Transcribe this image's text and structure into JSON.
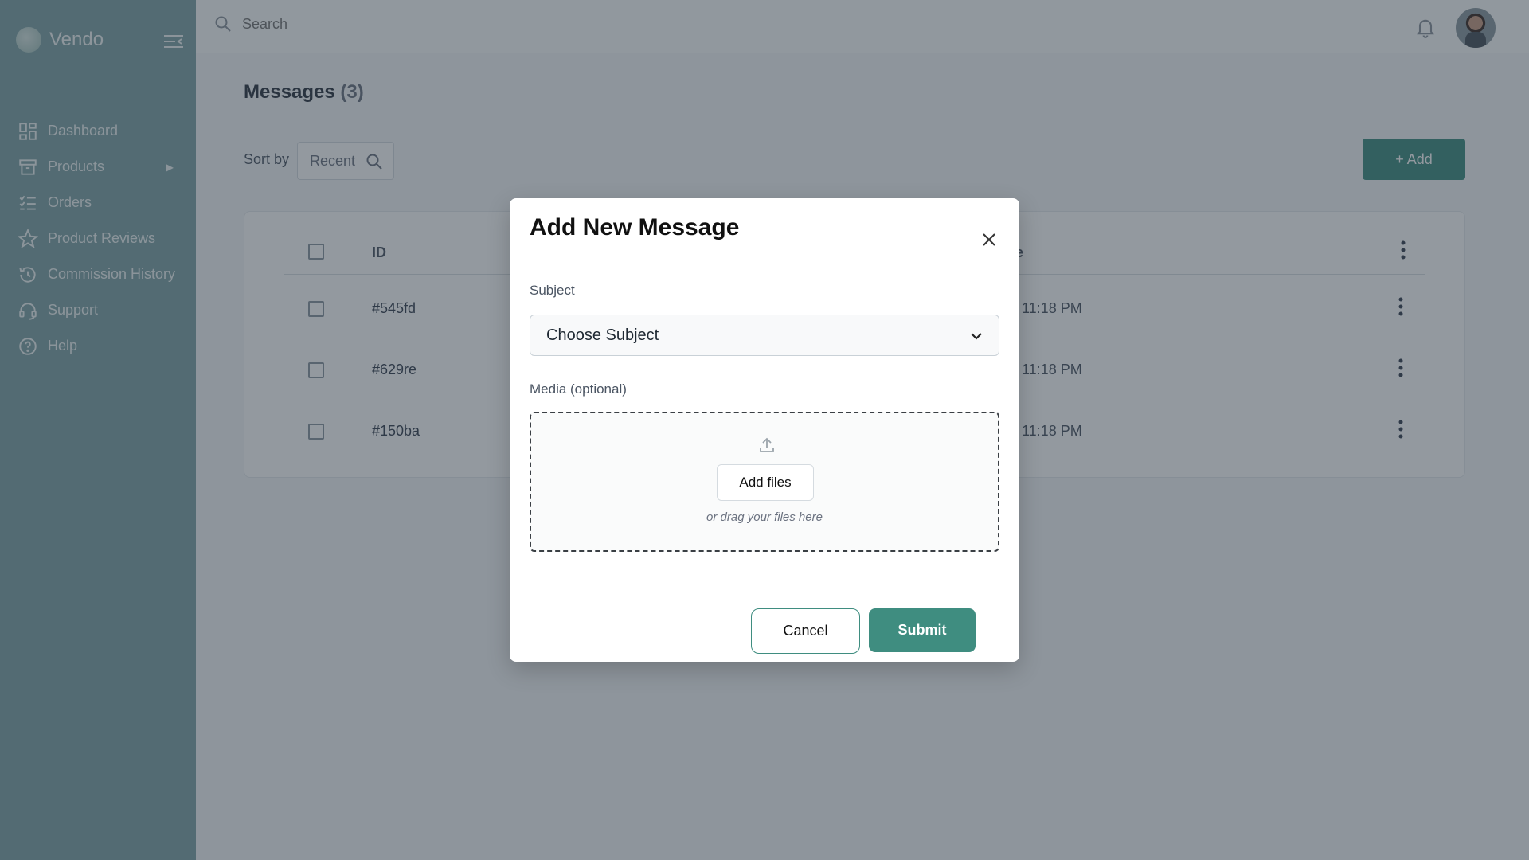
{
  "app": {
    "brand": "Vendo"
  },
  "sidebar": {
    "items": [
      {
        "label": "Dashboard",
        "icon": "dashboard-icon"
      },
      {
        "label": "Products",
        "icon": "box-icon",
        "expand": "▶"
      },
      {
        "label": "Orders",
        "icon": "checklist-icon"
      },
      {
        "label": "Product Reviews",
        "icon": "star-icon"
      },
      {
        "label": "Commission History",
        "icon": "history-icon"
      },
      {
        "label": "Support",
        "icon": "headset-icon"
      },
      {
        "label": "Help",
        "icon": "help-icon"
      }
    ]
  },
  "topbar": {
    "search_placeholder": "Search"
  },
  "page": {
    "title": "Messages",
    "count": "(3)",
    "sort_label": "Sort by",
    "sort_value": "Recent",
    "add_label": "+ Add"
  },
  "table": {
    "headers": {
      "id": "ID",
      "partial": "e"
    },
    "rows": [
      {
        "id": "#545fd",
        "time": "11:18 PM"
      },
      {
        "id": "#629re",
        "time": "11:18 PM"
      },
      {
        "id": "#150ba",
        "time": "11:18 PM"
      }
    ]
  },
  "modal": {
    "title": "Add New Message",
    "subject_label": "Subject",
    "subject_value": "Choose Subject",
    "media_label": "Media (optional)",
    "add_files": "Add files",
    "drag_hint": "or drag your files here",
    "cancel": "Cancel",
    "submit": "Submit"
  },
  "colors": {
    "sidebar": "#7ea3a7",
    "accent": "#3f8d80",
    "overlay": "rgba(40,52,64,0.5)"
  }
}
